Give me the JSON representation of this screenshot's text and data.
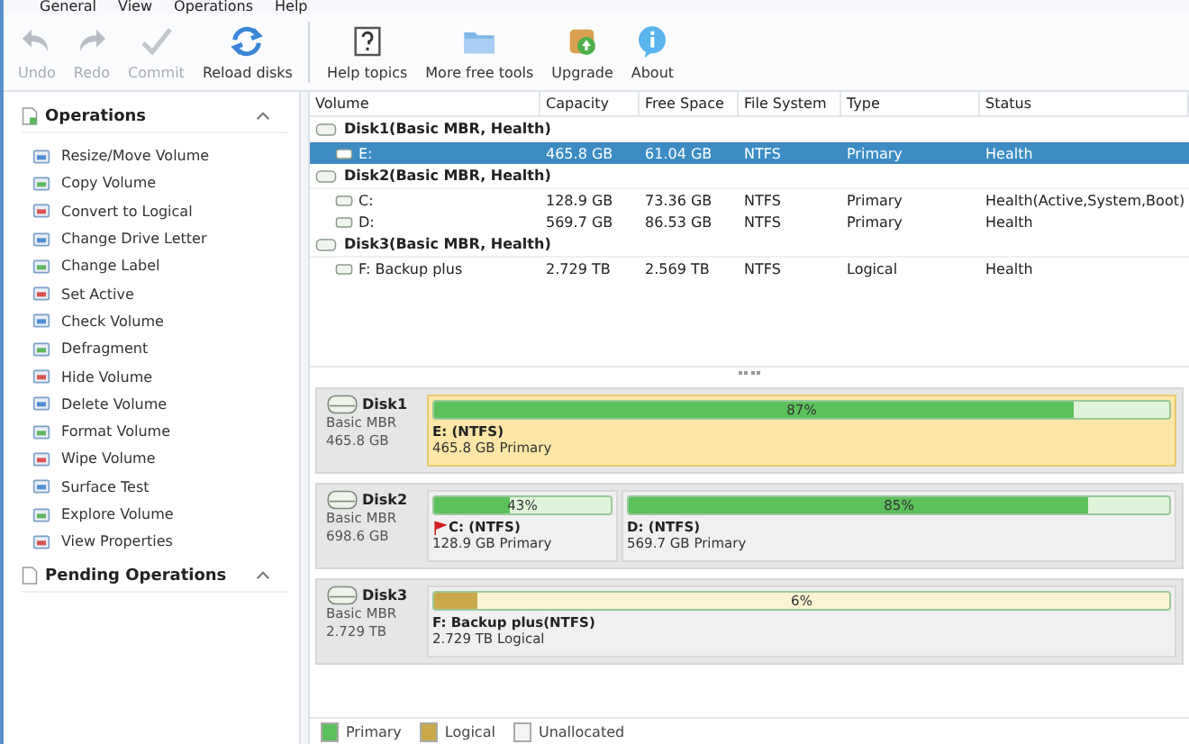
{
  "menu": [
    "General",
    "View",
    "Operations",
    "Help"
  ],
  "toolbar": [
    {
      "label": "Undo",
      "kind": "undo",
      "disabled": true,
      "separator": false
    },
    {
      "label": "Redo",
      "kind": "redo",
      "disabled": true,
      "separator": false
    },
    {
      "label": "Commit",
      "kind": "check",
      "disabled": true,
      "separator": false
    },
    {
      "label": "Reload disks",
      "kind": "reload",
      "disabled": false,
      "separator": false
    },
    {
      "label": "Help topics",
      "kind": "help",
      "disabled": false,
      "separator": true
    },
    {
      "label": "More free tools",
      "kind": "folder",
      "disabled": false,
      "separator": false
    },
    {
      "label": "Upgrade",
      "kind": "upgrade",
      "disabled": false,
      "separator": false
    },
    {
      "label": "About",
      "kind": "info",
      "disabled": false,
      "separator": false
    }
  ],
  "sidebar": [
    {
      "title": "Operations",
      "expanded": true,
      "items": [
        "Resize/Move Volume",
        "Copy Volume",
        "Convert to Logical",
        "Change Drive Letter",
        "Change Label",
        "Set Active",
        "Check Volume",
        "Defragment",
        "Hide Volume",
        "Delete Volume",
        "Format Volume",
        "Wipe Volume",
        "Surface Test",
        "Explore Volume",
        "View Properties"
      ]
    },
    {
      "title": "Pending Operations",
      "expanded": true
    }
  ],
  "table": {
    "columns": [
      "Volume",
      "Capacity",
      "Free Space",
      "File System",
      "Type",
      "Status"
    ],
    "groups": [
      {
        "disk": "Disk1(Basic MBR, Health)",
        "rows": [
          {
            "cells": [
              "E:",
              "465.8 GB",
              "61.04 GB",
              "NTFS",
              "Primary",
              "Health"
            ],
            "selected": true
          }
        ]
      },
      {
        "disk": "Disk2(Basic MBR, Health)",
        "rows": [
          {
            "cells": [
              "C:",
              "128.9 GB",
              "73.36 GB",
              "NTFS",
              "Primary",
              "Health(Active,System,Boot)"
            ],
            "selected": false
          },
          {
            "cells": [
              "D:",
              "569.7 GB",
              "86.53 GB",
              "NTFS",
              "Primary",
              "Health"
            ],
            "selected": false
          }
        ]
      },
      {
        "disk": "Disk3(Basic MBR, Health)",
        "rows": [
          {
            "cells": [
              "F: Backup plus",
              "2.729 TB",
              "2.569 TB",
              "NTFS",
              "Logical",
              "Health"
            ],
            "selected": false
          }
        ]
      }
    ]
  },
  "disk_map": [
    {
      "name": "Disk1",
      "scheme": "Basic MBR",
      "size": "465.8 GB",
      "partitions": [
        {
          "kind": "primary",
          "level": 0.87,
          "percent": "87%",
          "name": "E: (NTFS)",
          "desc": "465.8 GB Primary",
          "selected": true,
          "active": false
        }
      ]
    },
    {
      "name": "Disk2",
      "scheme": "Basic MBR",
      "size": "698.6 GB",
      "partitions": [
        {
          "kind": "primary",
          "level": 0.43,
          "percent": "43%",
          "name": "C: (NTFS)",
          "desc": "128.9 GB Primary",
          "selected": false,
          "active": true
        },
        {
          "kind": "primary",
          "level": 0.85,
          "percent": "85%",
          "name": "D: (NTFS)",
          "desc": "569.7 GB Primary",
          "selected": false,
          "active": false
        }
      ]
    },
    {
      "name": "Disk3",
      "scheme": "Basic MBR",
      "size": "2.729 TB",
      "partitions": [
        {
          "kind": "logical",
          "level": 0.06,
          "percent": "6%",
          "name": "F: Backup plus(NTFS)",
          "desc": "2.729 TB Logical",
          "selected": false,
          "active": false
        }
      ]
    }
  ],
  "legend": [
    {
      "kind": "primary",
      "label": "Primary"
    },
    {
      "kind": "logical",
      "label": "Logical"
    },
    {
      "kind": "unallocated",
      "label": "Unallocated"
    }
  ]
}
